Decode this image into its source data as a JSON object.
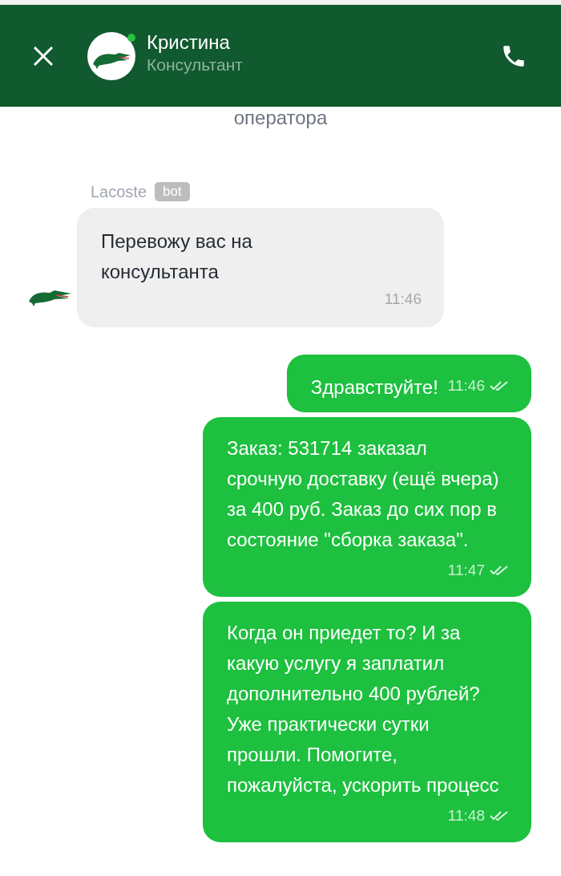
{
  "header": {
    "name": "Кристина",
    "role": "Консультант",
    "online": true
  },
  "system_text": "оператора",
  "messages": [
    {
      "kind": "incoming",
      "sender": "Lacoste",
      "badge": "bot",
      "text": "Перевожу вас на консультанта",
      "time": "11:46"
    },
    {
      "kind": "outgoing",
      "text": "Здравствуйте!",
      "time": "11:46",
      "read": true
    },
    {
      "kind": "outgoing",
      "text": "Заказ: 531714 заказал срочную доставку (ещё вчера) за 400 руб. Заказ до сих пор в состояние \"сборка заказа\".",
      "time": "11:47",
      "read": true
    },
    {
      "kind": "outgoing",
      "text": "Когда он приедет то? И за какую услугу я заплатил дополнительно 400 рублей? Уже практически сутки прошли. Помогите, пожалуйста, ускорить процесс",
      "time": "11:48",
      "read": true
    }
  ]
}
